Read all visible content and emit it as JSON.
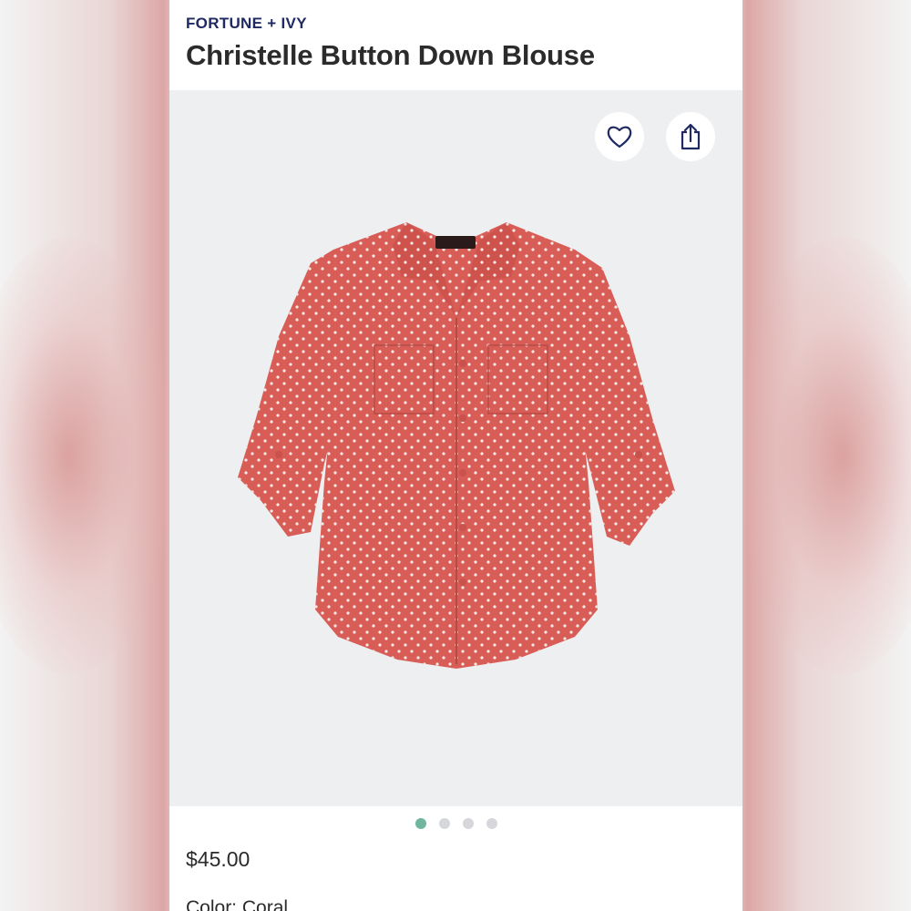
{
  "product": {
    "brand": "FORTUNE + IVY",
    "title": "Christelle Button Down Blouse",
    "price": "$45.00",
    "color_label": "Color:",
    "color_value": "Coral",
    "accent_color": "#d85d57"
  },
  "gallery": {
    "image_count": 4,
    "active_index": 0
  },
  "actions": {
    "favorite_icon": "heart-icon",
    "share_icon": "share-icon"
  }
}
